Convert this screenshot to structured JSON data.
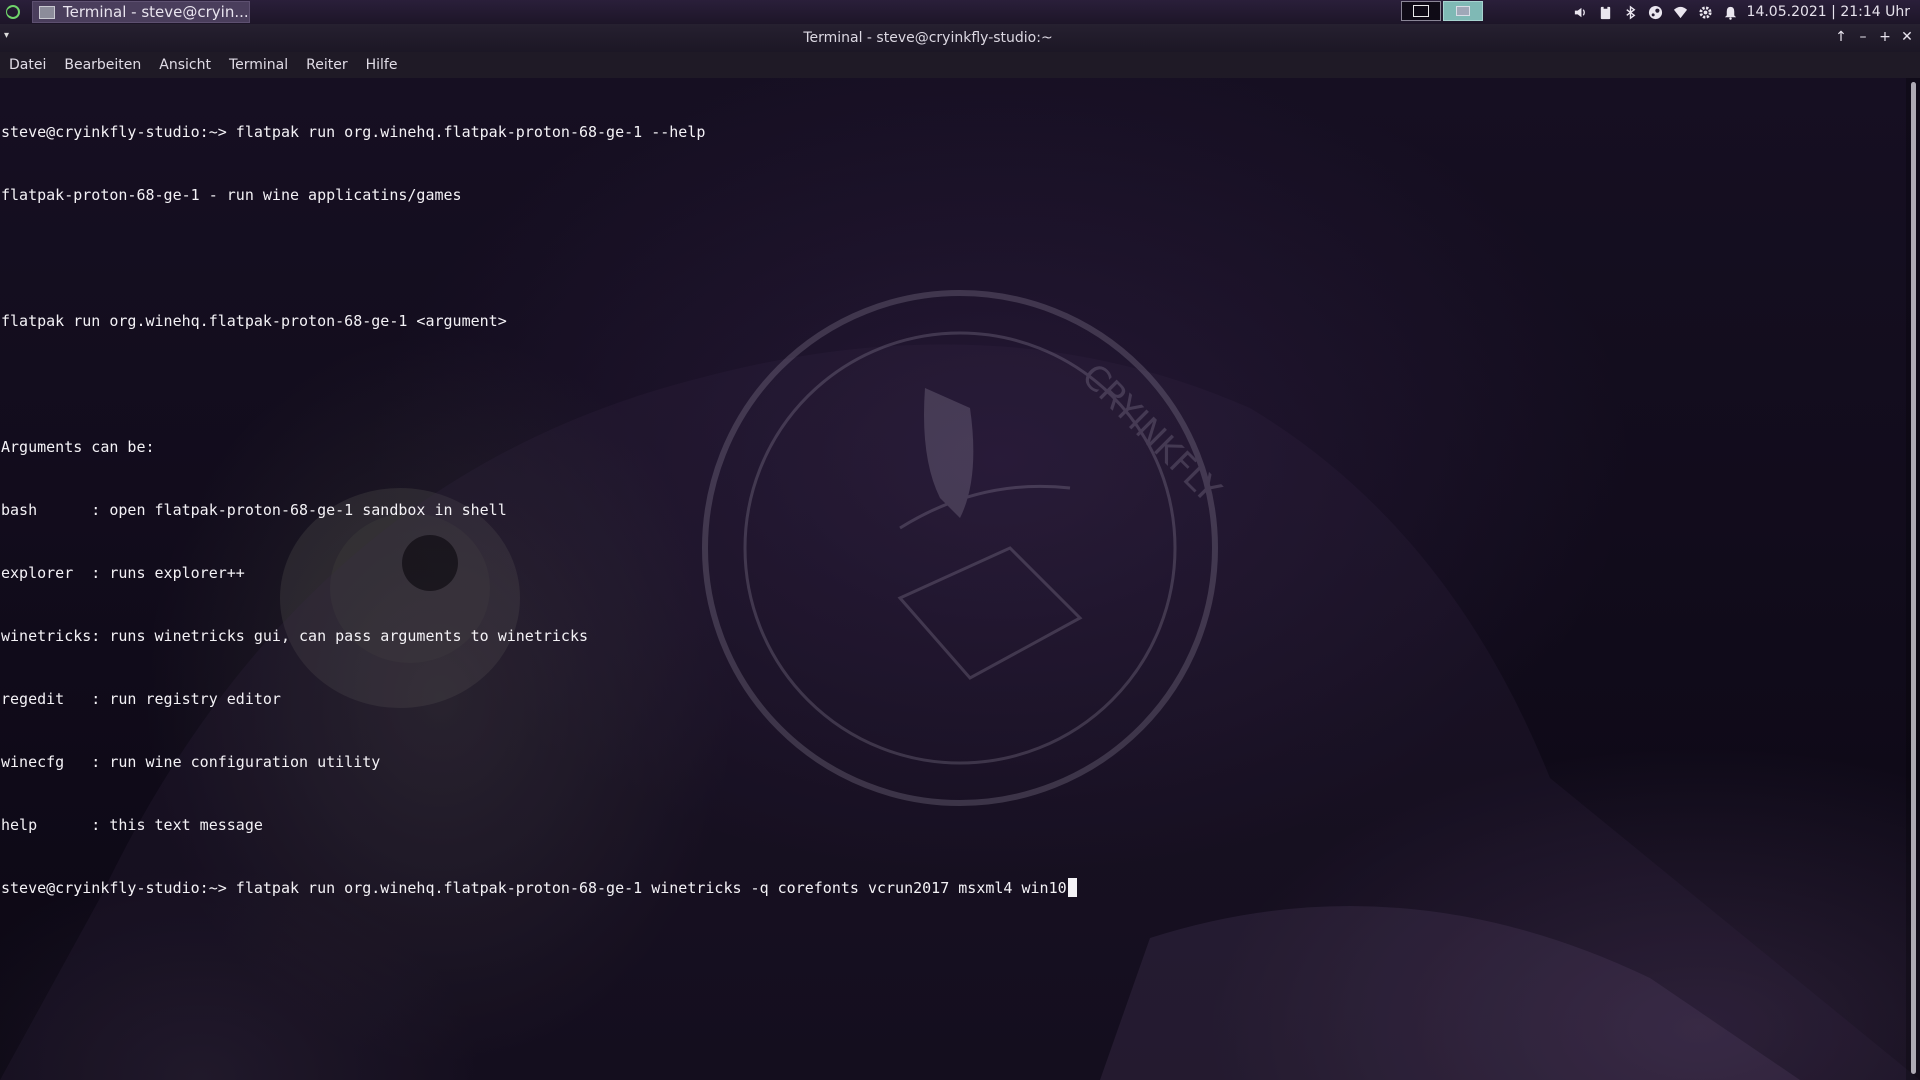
{
  "panel": {
    "app_menu_icon": "kde-launcher-icon",
    "taskbar_entry": {
      "label": "Terminal - steve@cryin...",
      "icon": "terminal-window-icon"
    },
    "pager": {
      "desktops": [
        "desktop-1",
        "desktop-2"
      ],
      "active_color": "#7fb9b5"
    },
    "tray_icons": [
      "volume-icon",
      "clipboard-icon",
      "bluetooth-icon",
      "steam-icon",
      "wifi-icon",
      "settings-icon",
      "notifications-icon"
    ],
    "clock": "14.05.2021 | 21:14 Uhr"
  },
  "window": {
    "title": "Terminal - steve@cryinkfly-studio:~",
    "buttons": {
      "keep_above": "↑",
      "minimize": "–",
      "maximize": "+",
      "close": "✕"
    },
    "menu": [
      "Datei",
      "Bearbeiten",
      "Ansicht",
      "Terminal",
      "Reiter",
      "Hilfe"
    ]
  },
  "terminal": {
    "lines": [
      "steve@cryinkfly-studio:~> flatpak run org.winehq.flatpak-proton-68-ge-1 --help",
      "flatpak-proton-68-ge-1 - run wine applicatins/games",
      "",
      "flatpak run org.winehq.flatpak-proton-68-ge-1 <argument>",
      "",
      "Arguments can be:",
      "bash      : open flatpak-proton-68-ge-1 sandbox in shell",
      "explorer  : runs explorer++",
      "winetricks: runs winetricks gui, can pass arguments to winetricks",
      "regedit   : run registry editor",
      "winecfg   : run wine configuration utility",
      "help      : this text message"
    ],
    "prompt_line": "steve@cryinkfly-studio:~> flatpak run org.winehq.flatpak-proton-68-ge-1 winetricks -q corefonts vcrun2017 msxml4 win10",
    "watermark_text": "CRYINKFLY"
  },
  "colors": {
    "terminal_fg": "#f4f2f6",
    "panel_bg": "#231a30",
    "accent": "#7fb9b5"
  }
}
